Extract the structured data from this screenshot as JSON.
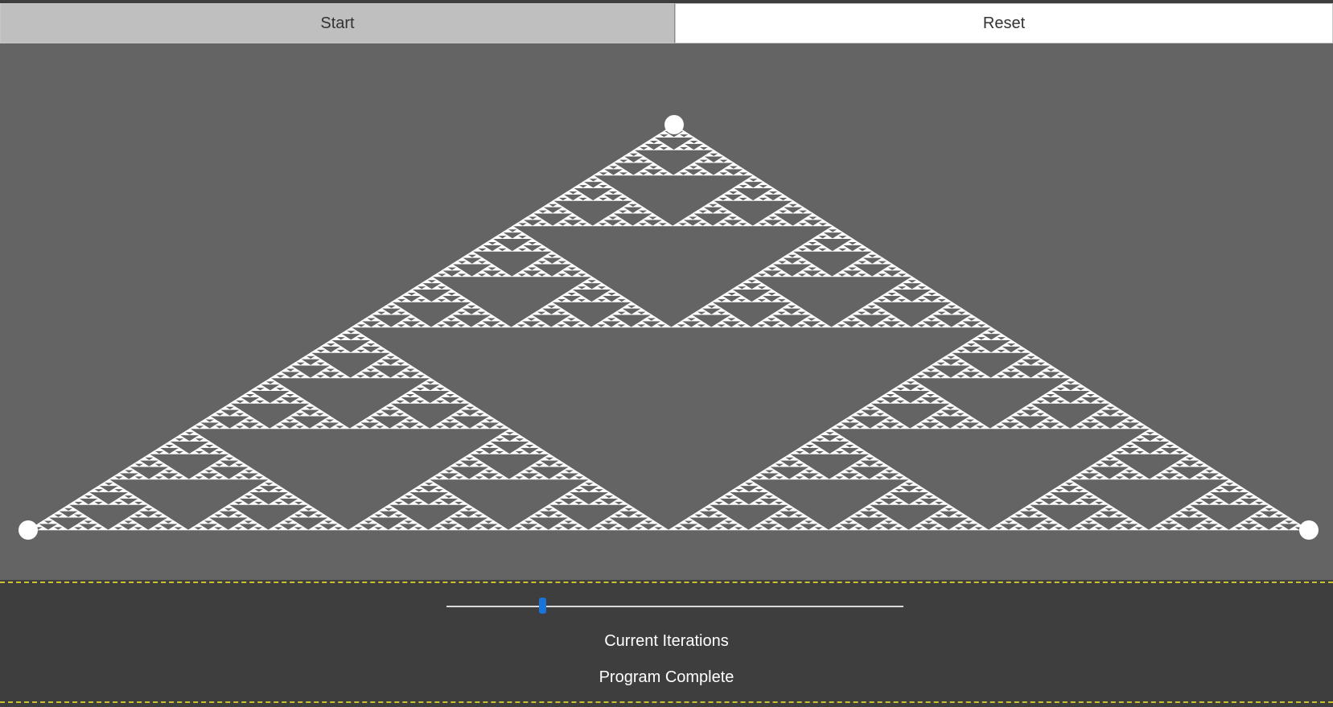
{
  "toolbar": {
    "start_label": "Start",
    "reset_label": "Reset"
  },
  "canvas": {
    "background_color": "#646464",
    "fractal_color": "#ffffff",
    "vertex_handles": [
      "top-vertex",
      "bottom-left-vertex",
      "bottom-right-vertex"
    ]
  },
  "controls": {
    "iterations_slider": {
      "min": 0,
      "max": 100,
      "value": 21
    },
    "accent_color": "#1a73d9",
    "current_iterations_label": "Current Iterations",
    "status_text": "Program Complete"
  }
}
